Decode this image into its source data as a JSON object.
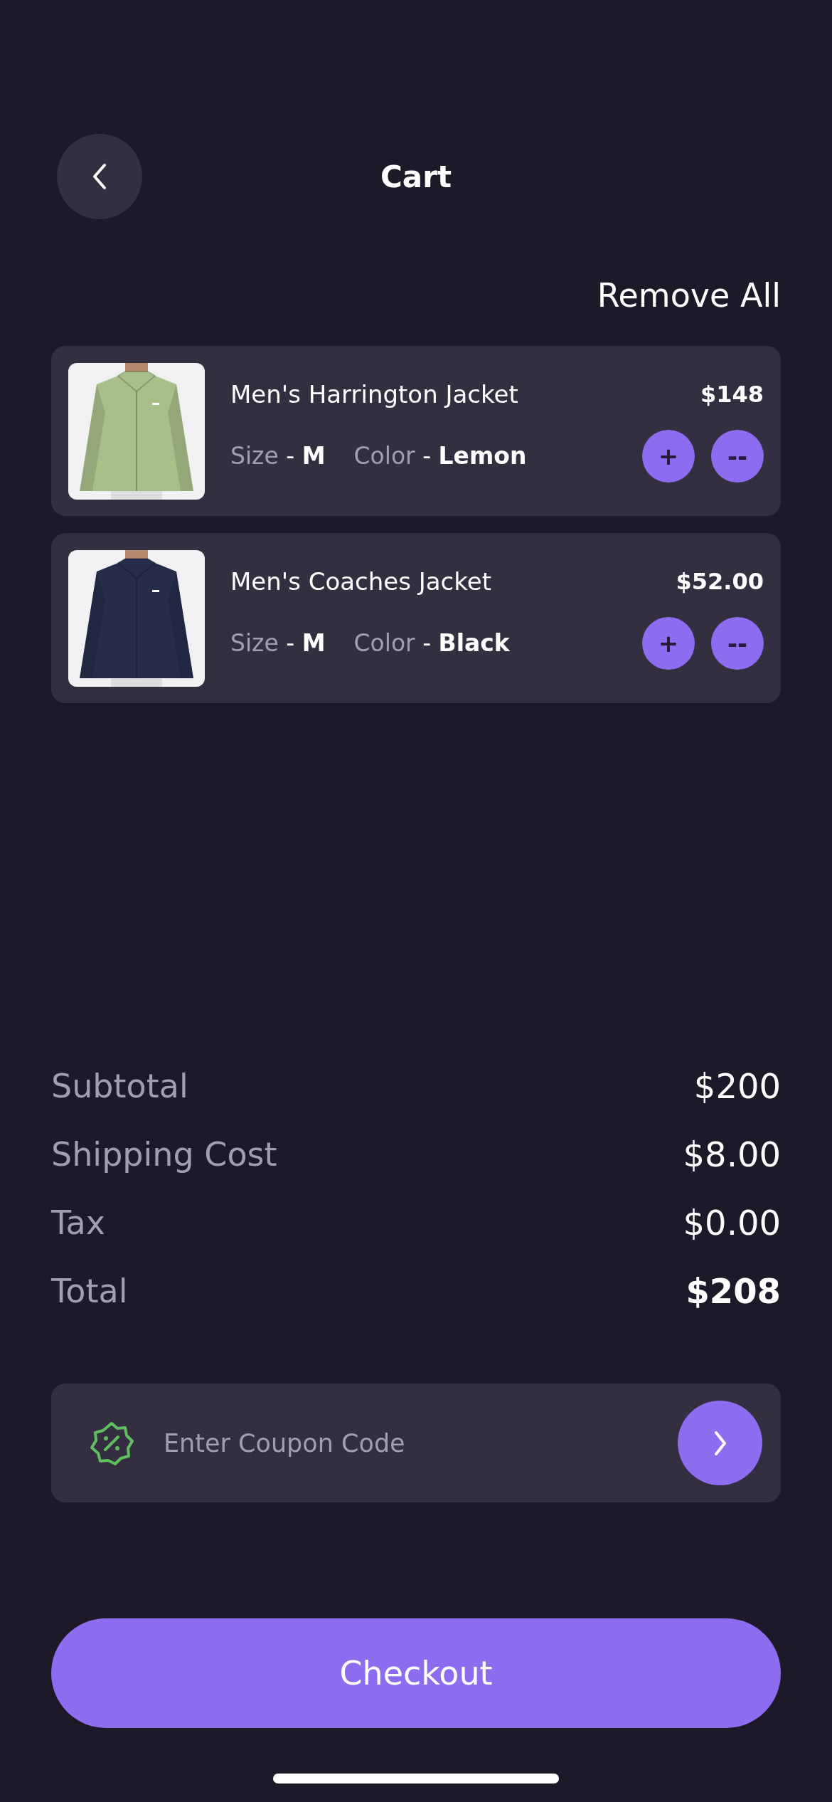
{
  "header": {
    "title": "Cart",
    "remove_all": "Remove All"
  },
  "items": [
    {
      "name": "Men's Harrington Jacket",
      "price": "$148",
      "size_label": "Size",
      "size_value": "- **M**",
      "color_label": "Color",
      "color_value": "- **Lemon**",
      "kind": "picture",
      "plus": "+",
      "minus": "--"
    },
    {
      "name": "Men's Coaches Jacket",
      "price": "$52.00",
      "size_label": "Size",
      "size_value": "- **M**",
      "color_label": "Color",
      "color_value": "- **Black**",
      "kind": "picture",
      "plus": "+",
      "minus": "--"
    }
  ],
  "summary": [
    {
      "label": "Subtotal",
      "value": "$200",
      "kind": "line"
    },
    {
      "label": "Shipping Cost",
      "value": "$8.00",
      "kind": "line"
    },
    {
      "label": "Tax",
      "value": "$0.00",
      "kind": "line"
    },
    {
      "label": "Total",
      "value": "$208",
      "kind": "total"
    }
  ],
  "coupon": {
    "placeholder": "Enter Coupon Code"
  },
  "checkout": "Checkout"
}
